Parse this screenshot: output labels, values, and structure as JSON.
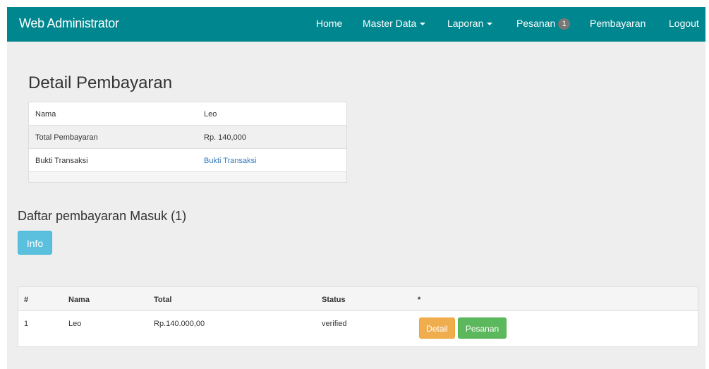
{
  "navbar": {
    "brand": "Web Administrator",
    "items": {
      "home": "Home",
      "master_data": "Master Data",
      "laporan": "Laporan",
      "pesanan": "Pesanan",
      "pesanan_badge": "1",
      "pembayaran": "Pembayaran",
      "logout": "Logout"
    }
  },
  "detail": {
    "title": "Detail Pembayaran",
    "rows": [
      {
        "label": "Nama",
        "value": "Leo"
      },
      {
        "label": "Total Pembayaran",
        "value": "Rp. 140,000"
      },
      {
        "label": "Bukti Transaksi",
        "value": "Bukti Transaksi"
      }
    ]
  },
  "list": {
    "title": "Daftar pembayaran Masuk (1)",
    "info_button": "Info",
    "headers": [
      "#",
      "Nama",
      "Total",
      "Status",
      "*"
    ],
    "rows": [
      {
        "no": "1",
        "nama": "Leo",
        "total": "Rp.140.000,00",
        "status": "verified",
        "detail_button": "Detail",
        "pesanan_button": "Pesanan"
      }
    ]
  },
  "colors": {
    "navbar": "#00868f",
    "info": "#5bc0de",
    "warning": "#f0ad4e",
    "success": "#5cb85c",
    "link": "#337ab7"
  }
}
